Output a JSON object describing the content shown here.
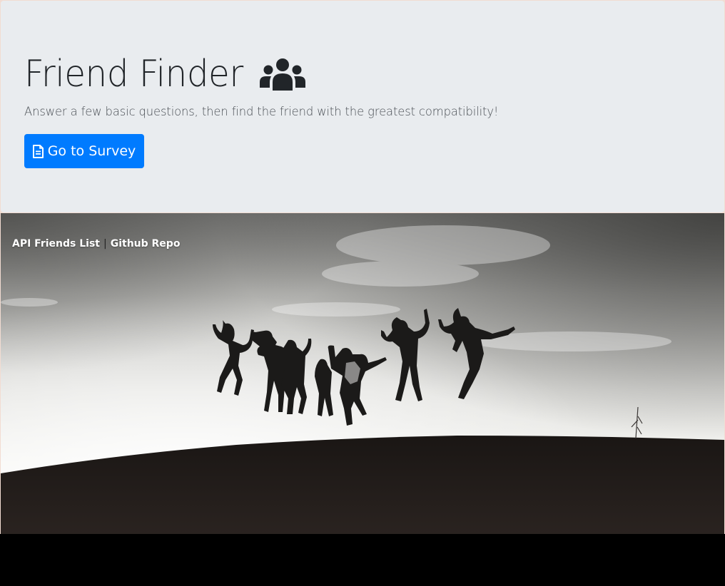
{
  "jumbotron": {
    "title": "Friend Finder",
    "title_icon": "users-icon",
    "lead": "Answer a few basic questions, then find the friend with the greatest compatibility!",
    "survey_button": {
      "icon": "file-text-icon",
      "label": "Go to Survey"
    }
  },
  "hero": {
    "links": {
      "friends_list": "API Friends List",
      "separator": "|",
      "github": "Github Repo"
    }
  },
  "colors": {
    "jumbotron_bg": "#e9ecef",
    "button_bg": "#007bff",
    "title_text": "#212529"
  }
}
